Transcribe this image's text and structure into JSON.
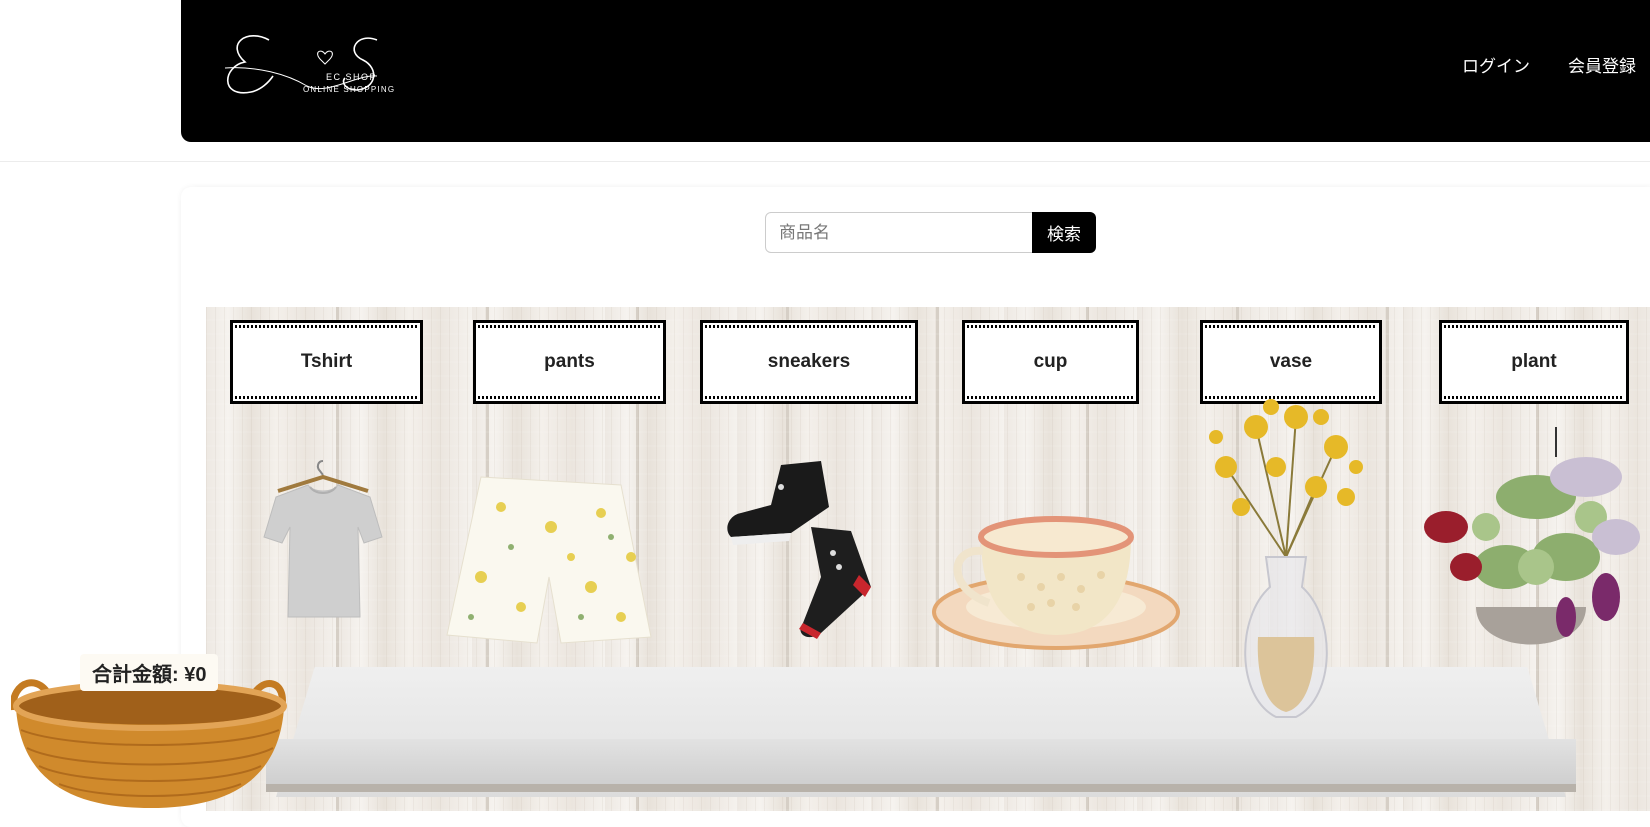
{
  "header": {
    "logo_sub1": "EC SHOP",
    "logo_sub2": "ONLINE SHOPPING",
    "nav": {
      "login": "ログイン",
      "register": "会員登録"
    }
  },
  "search": {
    "placeholder": "商品名",
    "button": "検索"
  },
  "categories": [
    {
      "label": "Tshirt",
      "icon": "tshirt-icon"
    },
    {
      "label": "pants",
      "icon": "pants-icon"
    },
    {
      "label": "sneakers",
      "icon": "sneakers-icon"
    },
    {
      "label": "cup",
      "icon": "cup-icon"
    },
    {
      "label": "vase",
      "icon": "vase-icon"
    },
    {
      "label": "plant",
      "icon": "plant-icon"
    }
  ],
  "cart": {
    "total": "合計金額: ¥0",
    "icon": "basket-icon"
  },
  "colors": {
    "header_bg": "#000000",
    "button_bg": "#000000",
    "basket": "#d08a2c"
  }
}
